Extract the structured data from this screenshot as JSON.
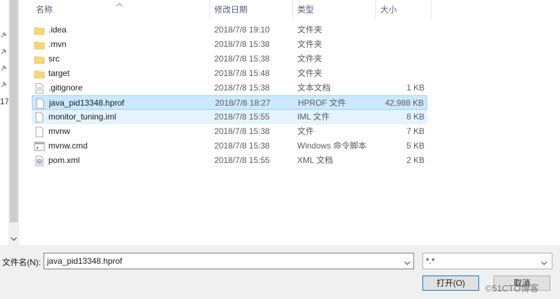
{
  "header": {
    "name": "名称",
    "date": "修改日期",
    "type": "类型",
    "size": "大小"
  },
  "left": {
    "label": "17"
  },
  "files": [
    {
      "icon": "folder-icon",
      "name": ".idea",
      "date": "2018/7/8 19:10",
      "type": "文件夹",
      "size": ""
    },
    {
      "icon": "folder-icon",
      "name": ".mvn",
      "date": "2018/7/8 15:38",
      "type": "文件夹",
      "size": ""
    },
    {
      "icon": "folder-icon",
      "name": "src",
      "date": "2018/7/8 15:38",
      "type": "文件夹",
      "size": ""
    },
    {
      "icon": "folder-icon",
      "name": "target",
      "date": "2018/7/8 15:48",
      "type": "文件夹",
      "size": ""
    },
    {
      "icon": "text-file-icon",
      "name": ".gitignore",
      "date": "2018/7/8 15:38",
      "type": "文本文档",
      "size": "1 KB"
    },
    {
      "icon": "file-icon",
      "name": "java_pid13348.hprof",
      "date": "2018/7/8 18:27",
      "type": "HPROF 文件",
      "size": "42,988 KB"
    },
    {
      "icon": "file-icon",
      "name": "monitor_tuning.iml",
      "date": "2018/7/8 15:55",
      "type": "IML 文件",
      "size": "8 KB"
    },
    {
      "icon": "file-icon",
      "name": "mvnw",
      "date": "2018/7/8 15:38",
      "type": "文件",
      "size": "7 KB"
    },
    {
      "icon": "cmd-file-icon",
      "name": "mvnw.cmd",
      "date": "2018/7/8 15:38",
      "type": "Windows 命令脚本",
      "size": "5 KB"
    },
    {
      "icon": "xml-file-icon",
      "name": "pom.xml",
      "date": "2018/7/8 15:55",
      "type": "XML 文档",
      "size": "2 KB"
    }
  ],
  "bottom": {
    "filename_label": "文件名(N):",
    "filename_value": "java_pid13348.hprof",
    "filter_value": "*.*",
    "open_label": "打开(O)",
    "cancel_label": "取消"
  },
  "watermark": "©51CTO博客",
  "colors": {
    "selected_bg": "#cce8ff",
    "selected_border": "#99d1ff",
    "hover_bg": "#e5f3ff",
    "folder": "#f8d775",
    "header_text": "#4c607a",
    "button_accent": "#0078d7"
  }
}
